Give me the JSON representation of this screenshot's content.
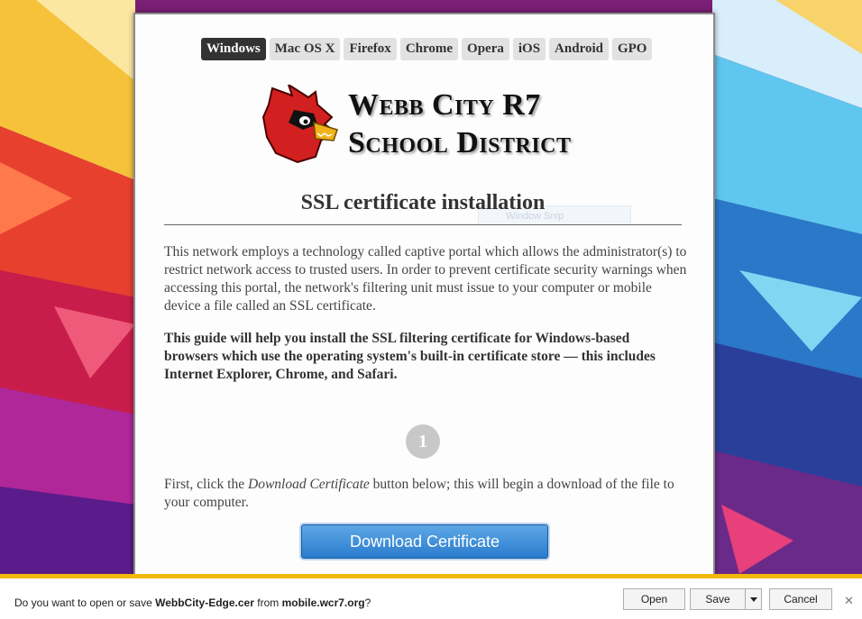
{
  "tabs": [
    {
      "label": "Windows",
      "active": true
    },
    {
      "label": "Mac OS X",
      "active": false
    },
    {
      "label": "Firefox",
      "active": false
    },
    {
      "label": "Chrome",
      "active": false
    },
    {
      "label": "Opera",
      "active": false
    },
    {
      "label": "iOS",
      "active": false
    },
    {
      "label": "Android",
      "active": false
    },
    {
      "label": "GPO",
      "active": false
    }
  ],
  "logo": {
    "line1": "Webb City R7",
    "line2": "School District",
    "icon": "cardinal-mascot-icon"
  },
  "title": "SSL certificate installation",
  "ghost_text": "Window Snip",
  "intro": "This network employs a technology called captive portal which allows the administrator(s) to restrict network access to trusted users. In order to prevent certificate security warnings when accessing this portal, the network's filtering unit must issue to your computer or mobile device a file called an SSL certificate.",
  "guide": "This guide will help you install the SSL filtering certificate for Windows-based browsers which use the operating system's built-in certificate store — this includes Internet Explorer, Chrome, and Safari.",
  "step": {
    "number": "1",
    "text_before": "First, click the ",
    "text_em": "Download Certificate",
    "text_after": " button below; this will begin a download of the file to your computer."
  },
  "download_button": "Download Certificate",
  "notification": {
    "prefix": "Do you want to open or save ",
    "filename": "WebbCity-Edge.cer",
    "middle": " from ",
    "domain": "mobile.wcr7.org",
    "suffix": "?",
    "open": "Open",
    "save": "Save",
    "cancel": "Cancel",
    "close_icon": "close-icon",
    "bar_color": "#f0b90b"
  },
  "colors": {
    "active_tab": "#333333",
    "button": "#2a7ccd"
  }
}
